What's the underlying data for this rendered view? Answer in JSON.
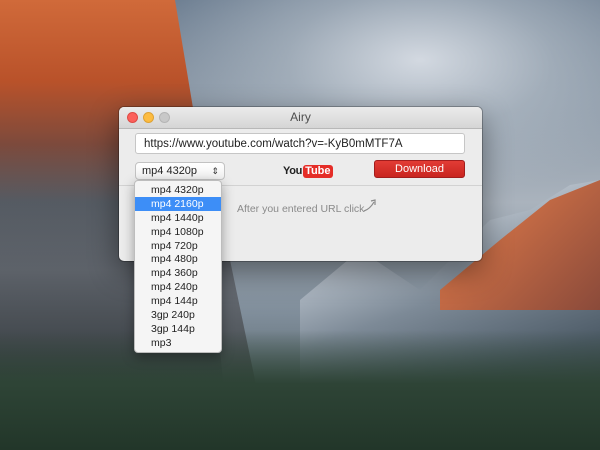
{
  "window": {
    "title": "Airy"
  },
  "url": {
    "value": "https://www.youtube.com/watch?v=-KyB0mMTF7A"
  },
  "format": {
    "selected": "mp4 4320p",
    "options": [
      "mp4 4320p",
      "mp4 2160p",
      "mp4 1440p",
      "mp4 1080p",
      "mp4 720p",
      "mp4 480p",
      "mp4 360p",
      "mp4 240p",
      "mp4 144p",
      "3gp 240p",
      "3gp 144p",
      "mp3"
    ],
    "highlighted": "mp4 2160p"
  },
  "logo": {
    "you": "You",
    "tube": "Tube"
  },
  "download": {
    "label": "Download"
  },
  "hint": {
    "text": "After you entered URL click"
  },
  "icons": {
    "chevron": "chevron-updown-icon",
    "hint_arrow": "curved-arrow-icon"
  },
  "colors": {
    "download_button": "#d42f29",
    "selection": "#3d8ef7",
    "youtube_red": "#e52d27"
  }
}
